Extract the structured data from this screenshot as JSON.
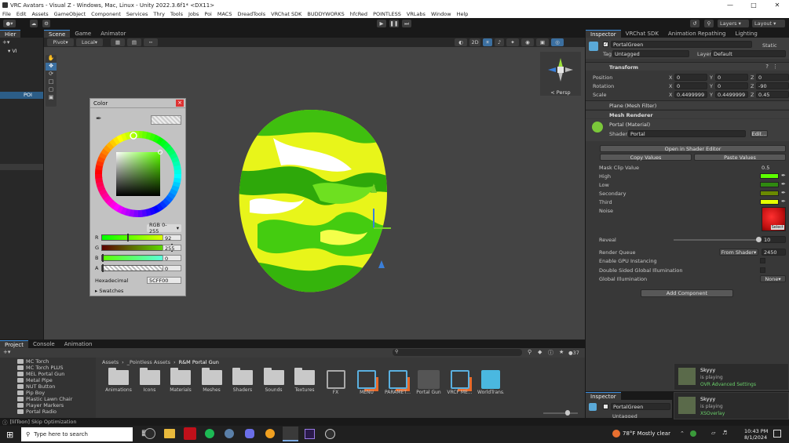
{
  "window": {
    "title": "VRC Avatars - Visual Z - Windows, Mac, Linux - Unity 2022.3.6f1* <DX11>"
  },
  "menu": [
    "File",
    "Edit",
    "Assets",
    "GameObject",
    "Component",
    "Services",
    "Thry",
    "Tools",
    "Jobs",
    "Poi",
    "MACS",
    "DreadTools",
    "VRChat SDK",
    "BUDDYWORKS",
    "hfcRed",
    "POINTLESS",
    "VRLabs",
    "Window",
    "Help"
  ],
  "toolbar": {
    "layers": "Layers",
    "layout": "Layout"
  },
  "scene_tabs": [
    "Scene",
    "Game",
    "Animator"
  ],
  "scene_toolbar": {
    "pivot": "Pivot",
    "local": "Local",
    "mode_2d": "2D",
    "persp": "< Persp"
  },
  "hierarchy": {
    "tab": "Hier",
    "root": "VI",
    "item": "POI"
  },
  "color_picker": {
    "title": "Color",
    "mode": "RGB 0-255",
    "channels": [
      {
        "name": "R",
        "value": "92"
      },
      {
        "name": "G",
        "value": "255"
      },
      {
        "name": "B",
        "value": "0"
      },
      {
        "name": "A",
        "value": "0"
      }
    ],
    "hex_label": "Hexadecimal",
    "hex_value": "5CFF00",
    "swatches": "Swatches"
  },
  "inspector": {
    "tabs": [
      "Inspector",
      "VRChat SDK",
      "Animation Repathing",
      "Lighting"
    ],
    "object_name": "PortalGreen",
    "static_label": "Static",
    "tag_label": "Tag",
    "tag_value": "Untagged",
    "layer_label": "Layer",
    "layer_value": "Default",
    "transform": {
      "title": "Transform",
      "position_label": "Position",
      "rotation_label": "Rotation",
      "scale_label": "Scale",
      "position": [
        "0",
        "0",
        "0"
      ],
      "rotation": [
        "0",
        "0",
        "-90"
      ],
      "scale": [
        "0.4499999",
        "0.4499999",
        "0.45"
      ]
    },
    "plane": "Plane (Mesh Filter)",
    "mesh_renderer": "Mesh Renderer",
    "material": "Portal (Material)",
    "shader_label": "Shader",
    "shader_value": "Portal",
    "edit": "Edit...",
    "open_shader_editor": "Open in Shader Editor",
    "copy_values": "Copy Values",
    "paste_values": "Paste Values",
    "properties": {
      "mask_clip_label": "Mask Clip Value",
      "mask_clip_value": "0.5",
      "high": "High",
      "low": "Low",
      "secondary": "Secondary",
      "third": "Third",
      "noise": "Noise",
      "select": "Select",
      "reveal": "Reveal",
      "reveal_value": "10",
      "reveal_fraction": 0.98,
      "render_queue": "Render Queue",
      "render_queue_mode": "From Shader",
      "render_queue_value": "2450",
      "gpu_instancing": "Enable GPU Instancing",
      "double_sided": "Double Sided Global Illumination",
      "global_illum": "Global Illumination",
      "global_illum_value": "None"
    },
    "swatch_colors": {
      "high": "#5cff00",
      "low": "#2f8a10",
      "secondary": "#6a8a00",
      "third": "#e6ff00",
      "noise": "#c01010"
    },
    "add_component": "Add Component"
  },
  "inspector2": {
    "tab": "Inspector",
    "object_name": "PortalGreen",
    "tag_value": "Untagged"
  },
  "project": {
    "tabs": [
      "Project",
      "Console",
      "Animation"
    ],
    "tree": [
      "MC Torch",
      "MC Torch PLUS",
      "MEL Portal Gun",
      "Metal Pipe",
      "NUT Button",
      "Pip Boy",
      "Plastic Lawn Chair",
      "Player Markers",
      "Portal Radio"
    ],
    "breadcrumb": [
      "Assets",
      "_Pointless Assets",
      "R&M Portal Gun"
    ],
    "assets": [
      "Animations",
      "Icons",
      "Materials",
      "Meshes",
      "Shaders",
      "Sounds",
      "Textures",
      "FX",
      "MENU",
      "PARAMET...",
      "Portal Gun",
      "VRCF ME...",
      "WorldTrans..."
    ],
    "count": "37"
  },
  "status": "[lilToon] Skip Optimization",
  "notifications": [
    {
      "name": "Skyyy",
      "status": "is playing",
      "game": "OVR Advanced Settings"
    },
    {
      "name": "Skyyy",
      "status": "is playing",
      "game": "XSOverlay"
    }
  ],
  "taskbar": {
    "search": "Type here to search",
    "weather": "78°F  Mostly clear",
    "time": "10:43 PM",
    "date": "8/1/2024"
  }
}
